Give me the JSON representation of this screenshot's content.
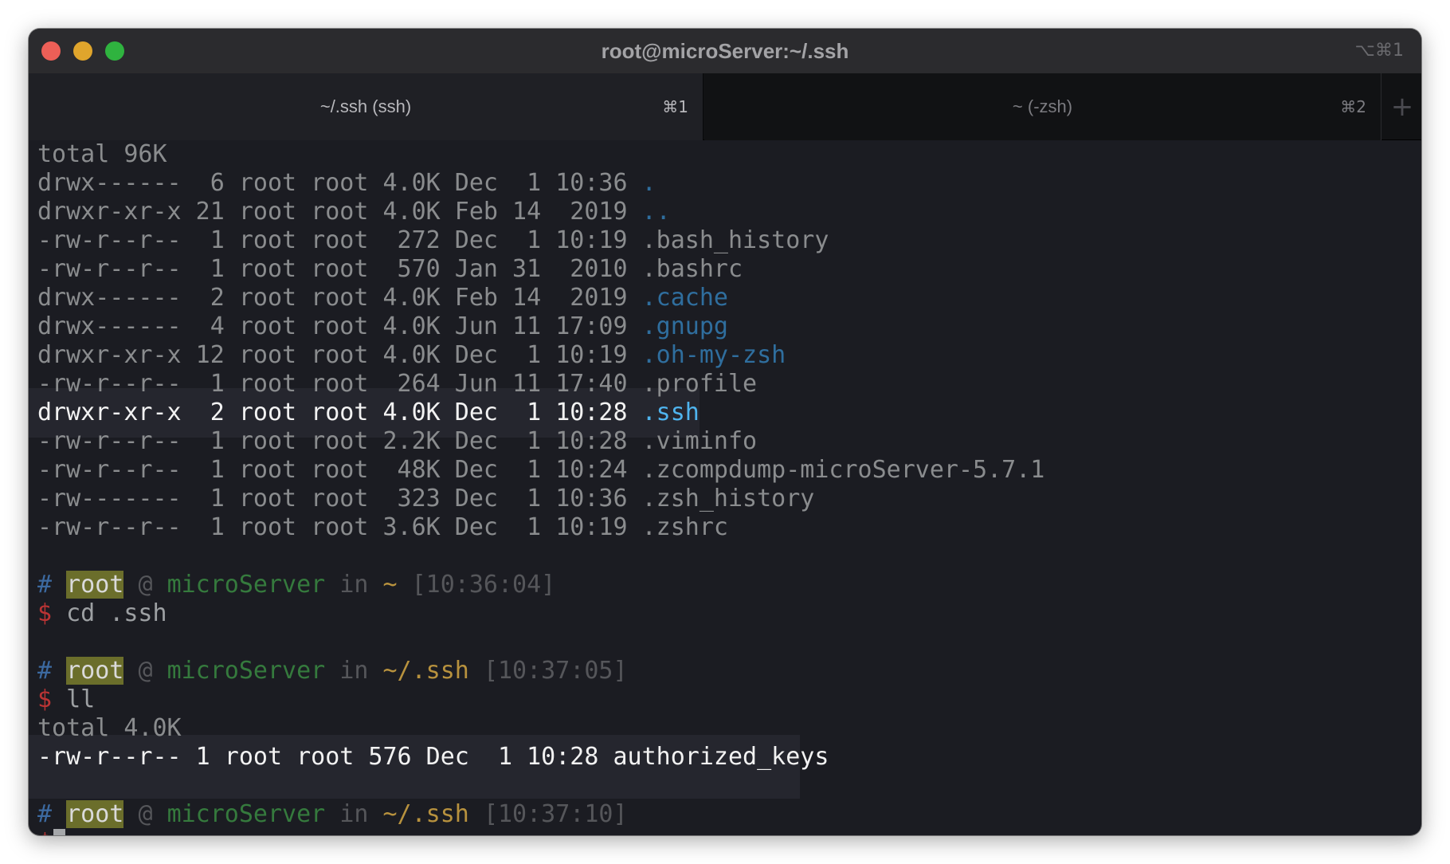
{
  "window": {
    "title": "root@microServer:~/.ssh",
    "shortcut": "⌥⌘1"
  },
  "tabs": [
    {
      "label": "~/.ssh (ssh)",
      "shortcut": "⌘1",
      "active": true
    },
    {
      "label": "~ (-zsh)",
      "shortcut": "⌘2",
      "active": false
    }
  ],
  "new_tab_label": "+",
  "listing": {
    "total": "total 96K",
    "rows": [
      {
        "meta": "drwx------  6 root root 4.0K Dec  1 10:36 ",
        "name": ".",
        "kind": "dir"
      },
      {
        "meta": "drwxr-xr-x 21 root root 4.0K Feb 14  2019 ",
        "name": "..",
        "kind": "dir"
      },
      {
        "meta": "-rw-r--r--  1 root root  272 Dec  1 10:19 ",
        "name": ".bash_history",
        "kind": "file"
      },
      {
        "meta": "-rw-r--r--  1 root root  570 Jan 31  2010 ",
        "name": ".bashrc",
        "kind": "file"
      },
      {
        "meta": "drwx------  2 root root 4.0K Feb 14  2019 ",
        "name": ".cache",
        "kind": "dir"
      },
      {
        "meta": "drwx------  4 root root 4.0K Jun 11 17:09 ",
        "name": ".gnupg",
        "kind": "dir"
      },
      {
        "meta": "drwxr-xr-x 12 root root 4.0K Dec  1 10:19 ",
        "name": ".oh-my-zsh",
        "kind": "dir"
      },
      {
        "meta": "-rw-r--r--  1 root root  264 Jun 11 17:40 ",
        "name": ".profile",
        "kind": "file"
      },
      {
        "meta": "drwxr-xr-x  2 root root 4.0K Dec  1 10:28 ",
        "name": ".ssh",
        "kind": "dir",
        "selected": true
      },
      {
        "meta": "-rw-r--r--  1 root root 2.2K Dec  1 10:28 ",
        "name": ".viminfo",
        "kind": "file"
      },
      {
        "meta": "-rw-r--r--  1 root root  48K Dec  1 10:24 ",
        "name": ".zcompdump-microServer-5.7.1",
        "kind": "file"
      },
      {
        "meta": "-rw-------  1 root root  323 Dec  1 10:36 ",
        "name": ".zsh_history",
        "kind": "file"
      },
      {
        "meta": "-rw-r--r--  1 root root 3.6K Dec  1 10:19 ",
        "name": ".zshrc",
        "kind": "file"
      }
    ]
  },
  "prompts": [
    {
      "hash": "#",
      "user": "root",
      "at": "@",
      "host": "microServer",
      "in": "in",
      "path": "~",
      "time": "[10:36:04]",
      "dollar": "$",
      "command": "cd .ssh"
    },
    {
      "hash": "#",
      "user": "root",
      "at": "@",
      "host": "microServer",
      "in": "in",
      "path": "~/.ssh",
      "time": "[10:37:05]",
      "dollar": "$",
      "command": "ll"
    },
    {
      "hash": "#",
      "user": "root",
      "at": "@",
      "host": "microServer",
      "in": "in",
      "path": "~/.ssh",
      "time": "[10:37:10]",
      "dollar": "$",
      "command": ""
    }
  ],
  "ll_output": {
    "total": "total 4.0K",
    "row": "-rw-r--r-- 1 root root 576 Dec  1 10:28 authorized_keys"
  }
}
